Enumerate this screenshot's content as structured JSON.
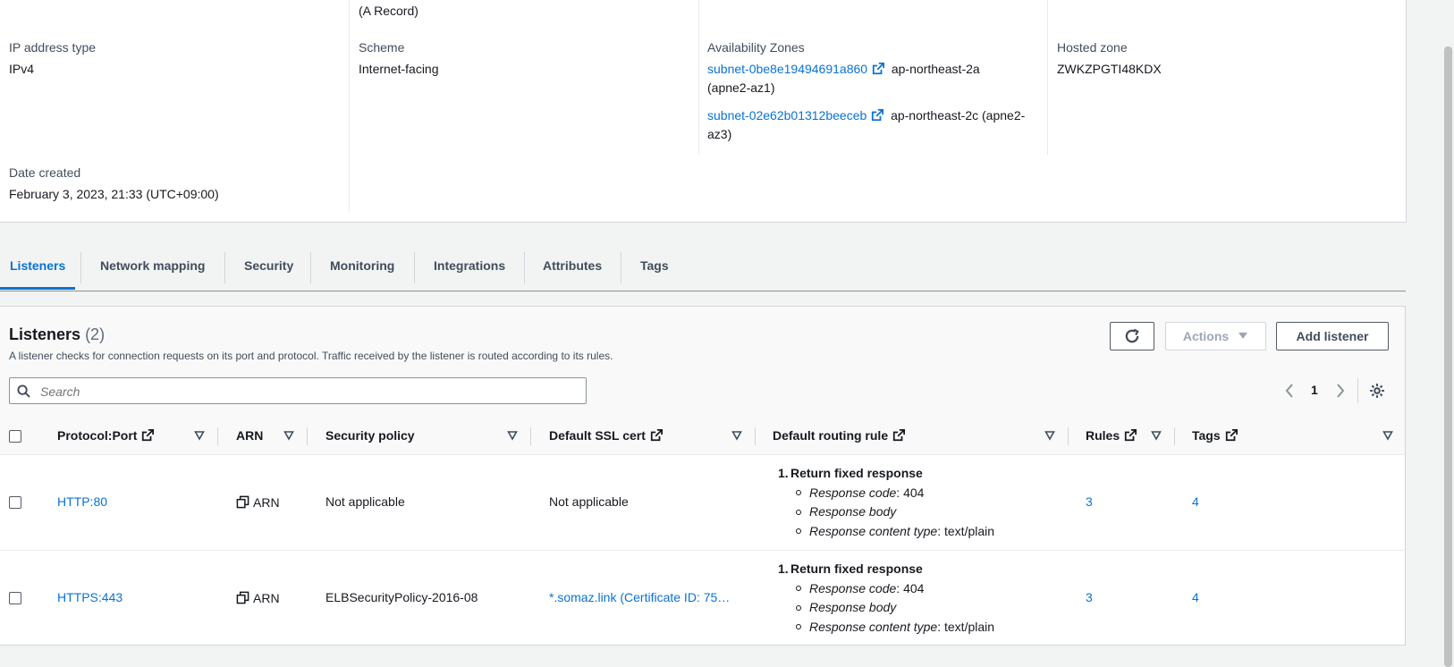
{
  "details": {
    "dns_record_suffix": "(A Record)",
    "ip_address_type": {
      "label": "IP address type",
      "value": "IPv4"
    },
    "scheme": {
      "label": "Scheme",
      "value": "Internet-facing"
    },
    "availability_zones": {
      "label": "Availability Zones",
      "subnets": [
        {
          "id": "subnet-0be8e19494691a860",
          "zone_line1": "ap-northeast-2a",
          "zone_line2": "(apne2-az1)"
        },
        {
          "id": "subnet-02e62b01312beeceb",
          "zone_line1": "ap-northeast-2c (apne2-",
          "zone_line2": "az3)"
        }
      ]
    },
    "hosted_zone": {
      "label": "Hosted zone",
      "value": "ZWKZPGTI48KDX"
    },
    "date_created": {
      "label": "Date created",
      "value": "February 3, 2023, 21:33 (UTC+09:00)"
    }
  },
  "tabs": [
    {
      "label": "Listeners",
      "active": true
    },
    {
      "label": "Network mapping"
    },
    {
      "label": "Security"
    },
    {
      "label": "Monitoring"
    },
    {
      "label": "Integrations"
    },
    {
      "label": "Attributes"
    },
    {
      "label": "Tags"
    }
  ],
  "listeners": {
    "title": "Listeners",
    "count": "(2)",
    "description": "A listener checks for connection requests on its port and protocol. Traffic received by the listener is routed according to its rules.",
    "actions_label": "Actions",
    "add_label": "Add listener",
    "search_placeholder": "Search",
    "page": "1",
    "columns": {
      "protocol_port": "Protocol:Port",
      "arn": "ARN",
      "security_policy": "Security policy",
      "ssl_cert": "Default SSL cert",
      "routing_rule": "Default routing rule",
      "rules": "Rules",
      "tags": "Tags"
    },
    "rows": [
      {
        "protocol_port": "HTTP:80",
        "arn": "ARN",
        "security_policy": "Not applicable",
        "ssl_cert": "Not applicable",
        "rule_head": "Return fixed response",
        "rule_code_label": "Response code",
        "rule_code_value": ": 404",
        "rule_body_label": "Response body",
        "rule_ct_label": "Response content type",
        "rule_ct_value": ": text/plain",
        "rules": "3",
        "tags": "4"
      },
      {
        "protocol_port": "HTTPS:443",
        "arn": "ARN",
        "security_policy": "ELBSecurityPolicy-2016-08",
        "ssl_cert": "*.somaz.link (Certificate ID: 75…",
        "rule_head": "Return fixed response",
        "rule_code_label": "Response code",
        "rule_code_value": ": 404",
        "rule_body_label": "Response body",
        "rule_ct_label": "Response content type",
        "rule_ct_value": ": text/plain",
        "rules": "3",
        "tags": "4"
      }
    ]
  },
  "colors": {
    "link": "#0972d3",
    "text": "#16191f",
    "secondary": "#414d5c",
    "border": "#d1d5db"
  }
}
